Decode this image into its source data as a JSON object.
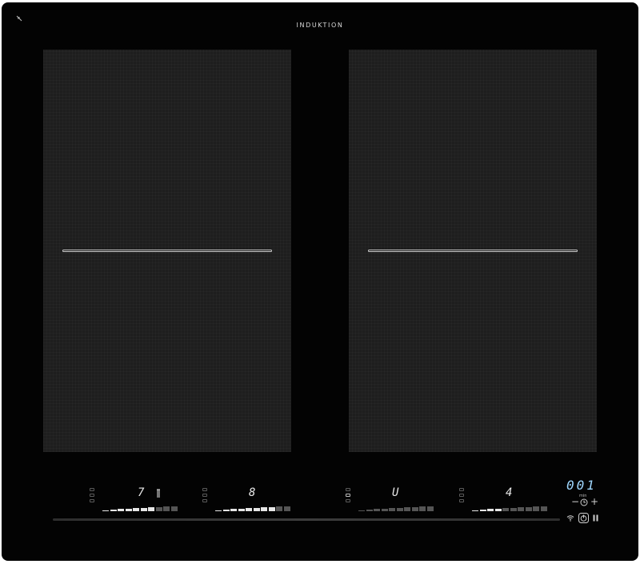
{
  "brand": {
    "label": "INDUKTION"
  },
  "icons": {
    "corner": "key-lock-icon",
    "pot": "pot-indicator-icon",
    "timer": "clock-icon",
    "wifi": "wifi-icon",
    "power": "power-icon",
    "pause": "pause-icon"
  },
  "zones": [
    {
      "name": "front-left",
      "display": "7",
      "level": 7,
      "max_level": 10
    },
    {
      "name": "rear-left",
      "display": "8",
      "level": 8,
      "max_level": 10
    },
    {
      "name": "rear-right",
      "display": "U",
      "level": 0,
      "max_level": 10
    },
    {
      "name": "front-right",
      "display": "4",
      "level": 4,
      "max_level": 10
    }
  ],
  "timer": {
    "value": "001",
    "unit": "min",
    "minus": "−",
    "plus": "+"
  },
  "colors": {
    "panel": "#030303",
    "zone": "#1e1e1e",
    "display": "#e8e8e8",
    "timer_display": "#9fd7ff"
  }
}
